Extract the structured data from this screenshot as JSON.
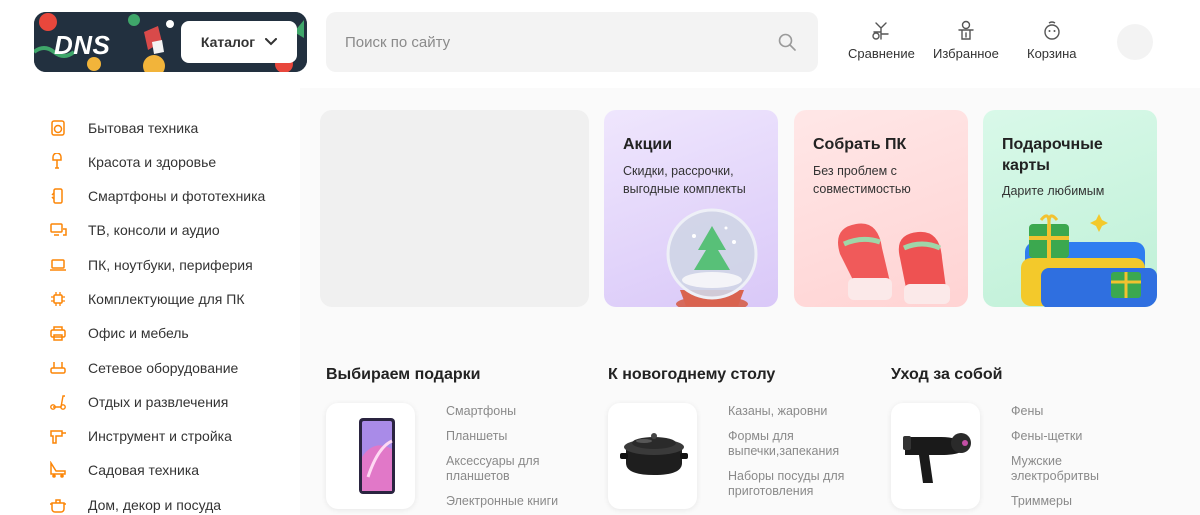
{
  "header": {
    "logo": "DNS",
    "catalog_label": "Каталог",
    "search_placeholder": "Поиск по сайту",
    "actions": [
      {
        "label": "Сравнение",
        "icon": "compare-icon"
      },
      {
        "label": "Избранное",
        "icon": "favorites-icon"
      },
      {
        "label": "Корзина",
        "icon": "cart-icon"
      }
    ]
  },
  "sidebar": {
    "items": [
      {
        "label": "Бытовая техника",
        "icon": "appliances-icon"
      },
      {
        "label": "Красота и здоровье",
        "icon": "beauty-icon"
      },
      {
        "label": "Смартфоны и фототехника",
        "icon": "smartphone-icon"
      },
      {
        "label": "ТВ, консоли и аудио",
        "icon": "tv-icon"
      },
      {
        "label": "ПК, ноутбуки, периферия",
        "icon": "laptop-icon"
      },
      {
        "label": "Комплектующие для ПК",
        "icon": "chip-icon"
      },
      {
        "label": "Офис и мебель",
        "icon": "printer-icon"
      },
      {
        "label": "Сетевое оборудование",
        "icon": "router-icon"
      },
      {
        "label": "Отдых и развлечения",
        "icon": "scooter-icon"
      },
      {
        "label": "Инструмент и стройка",
        "icon": "drill-icon"
      },
      {
        "label": "Садовая техника",
        "icon": "mower-icon"
      },
      {
        "label": "Дом, декор и посуда",
        "icon": "pot-icon"
      }
    ]
  },
  "promos": [
    {
      "title": "Акции",
      "subtitle": "Скидки, рассрочки, выгодные комплекты"
    },
    {
      "title": "Собрать ПК",
      "subtitle": "Без проблем с совместимостью"
    },
    {
      "title": "Подарочные карты",
      "subtitle": "Дарите любимым"
    }
  ],
  "sections": [
    {
      "title": "Выбираем подарки",
      "image": "smartphone-image",
      "links": [
        "Смартфоны",
        "Планшеты",
        "Аксессуары для планшетов",
        "Электронные книги"
      ]
    },
    {
      "title": "К новогоднему столу",
      "image": "pot-image",
      "links": [
        "Казаны, жаровни",
        "Формы для выпечки,запекания",
        "Наборы посуды для приготовления"
      ]
    },
    {
      "title": "Уход за собой",
      "image": "hairdryer-image",
      "links": [
        "Фены",
        "Фены-щетки",
        "Мужские электробритвы",
        "Триммеры"
      ]
    }
  ],
  "colors": {
    "accent": "#fc8507",
    "card_purple": "#e3d6fb",
    "card_pink": "#ffdede",
    "card_green": "#cdf5e2"
  }
}
